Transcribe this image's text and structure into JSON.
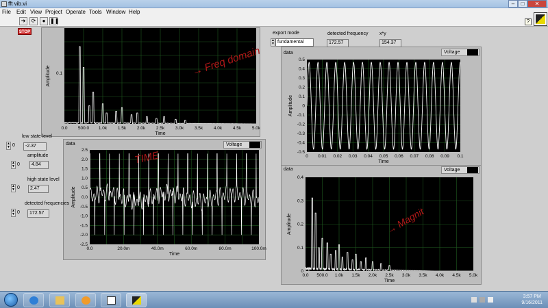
{
  "window": {
    "title": "fft vib.vi"
  },
  "menu": [
    "File",
    "Edit",
    "View",
    "Project",
    "Operate",
    "Tools",
    "Window",
    "Help"
  ],
  "toolbar": {
    "stop_label": "STOP",
    "help_label": "?"
  },
  "controls": {
    "export_mode": {
      "label": "export mode",
      "value": "fundamental"
    },
    "detected_frequency": {
      "label": "detected frequency",
      "value": "172.57"
    },
    "xy": {
      "label": "x*y",
      "value": "154.37"
    },
    "low_state_level": {
      "label": "low state level",
      "value": "-2.37",
      "spin": "0"
    },
    "amplitude": {
      "label": "amplitude",
      "value": "4.84",
      "spin": "0"
    },
    "high_state_level": {
      "label": "high state level",
      "value": "2.47",
      "spin": "0"
    },
    "detected_frequencies": {
      "label": "detected frequencies",
      "value": "172.57",
      "spin": "0"
    }
  },
  "graphs": {
    "freq_top": {
      "ylabel": "Amplitude",
      "xlabel": "Time",
      "yticks": [
        "0.1"
      ],
      "xticks": [
        "0.0",
        "500.0",
        "1.0k",
        "1.5k",
        "2.0k",
        "2.5k",
        "3.0k",
        "3.5k",
        "4.0k",
        "4.5k",
        "5.0k"
      ],
      "annotation": "→ Freq domain"
    },
    "time_left": {
      "title": "data",
      "legend": "Voltage",
      "ylabel": "Amplitude",
      "xlabel": "Time",
      "yticks": [
        "2.5",
        "2.0",
        "1.5",
        "1.0",
        "0.5",
        "0.0",
        "-0.5",
        "-1.0",
        "-1.5",
        "-2.0",
        "-2.5"
      ],
      "xticks": [
        "0.0",
        "20.0m",
        "40.0m",
        "60.0m",
        "80.0m",
        "100.0m"
      ],
      "annotation": "TIME"
    },
    "sine_right": {
      "title": "data",
      "legend": "Voltage",
      "ylabel": "Amplitude",
      "xlabel": "Time",
      "yticks": [
        "0.5",
        "0.4",
        "0.3",
        "0.2",
        "0.1",
        "0",
        "-0.1",
        "-0.2",
        "-0.3",
        "-0.4",
        "-0.5"
      ],
      "xticks": [
        "0",
        "0.01",
        "0.02",
        "0.03",
        "0.04",
        "0.05",
        "0.06",
        "0.07",
        "0.08",
        "0.09",
        "0.1"
      ]
    },
    "mag_right": {
      "title": "data",
      "legend": "Voltage",
      "ylabel": "Amplitude",
      "xlabel": "Time",
      "yticks": [
        "0.4",
        "0.3",
        "0.2",
        "0.1",
        "0"
      ],
      "xticks": [
        "0.0",
        "500.0",
        "1.0k",
        "1.5k",
        "2.0k",
        "2.5k",
        "3.0k",
        "3.5k",
        "4.0k",
        "4.5k",
        "5.0k"
      ],
      "annotation": "→ Magnit"
    }
  },
  "taskbar": {
    "time": "3:57 PM",
    "date": "9/16/2011"
  }
}
